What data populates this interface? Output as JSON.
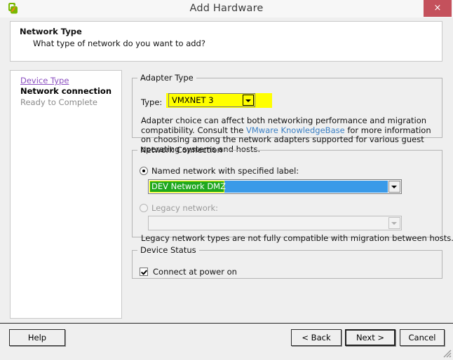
{
  "window": {
    "title": "Add Hardware",
    "icon": "vsphere-app-icon",
    "close_label": "×"
  },
  "header": {
    "title": "Network Type",
    "subtitle": "What type of network do you want to add?"
  },
  "sidebar": {
    "items": [
      {
        "label": "Device Type",
        "state": "link"
      },
      {
        "label": "Network connection",
        "state": "current"
      },
      {
        "label": "Ready to Complete",
        "state": "pending"
      }
    ]
  },
  "adapter_type": {
    "legend": "Adapter Type",
    "type_label": "Type:",
    "type_value": "VMXNET 3",
    "hint_part1": "Adapter choice can affect both networking performance and migration compatibility. Consult the ",
    "hint_link": "VMware KnowledgeBase",
    "hint_part2": " for more information on choosing among the network adapters supported for various guest operating systems and hosts."
  },
  "network_connection": {
    "legend": "Network Connection",
    "named_radio_label": "Named network with specified label:",
    "named_value": "DEV Network DMZ",
    "legacy_radio_label": "Legacy network:",
    "legacy_value": "",
    "legacy_note": "Legacy network types are not fully compatible with migration between hosts."
  },
  "device_status": {
    "legend": "Device Status",
    "connect_label": "Connect at power on"
  },
  "footer": {
    "help_label": "Help",
    "back_label": "< Back",
    "next_label": "Next >",
    "cancel_label": "Cancel"
  },
  "colors": {
    "highlight_yellow": "#ffff00",
    "highlight_green": "#1fa81f",
    "selection_blue": "#3a9ae8",
    "link_purple": "#8b4fc0",
    "link_blue": "#3a7fc4",
    "close_red": "#c4515c"
  }
}
